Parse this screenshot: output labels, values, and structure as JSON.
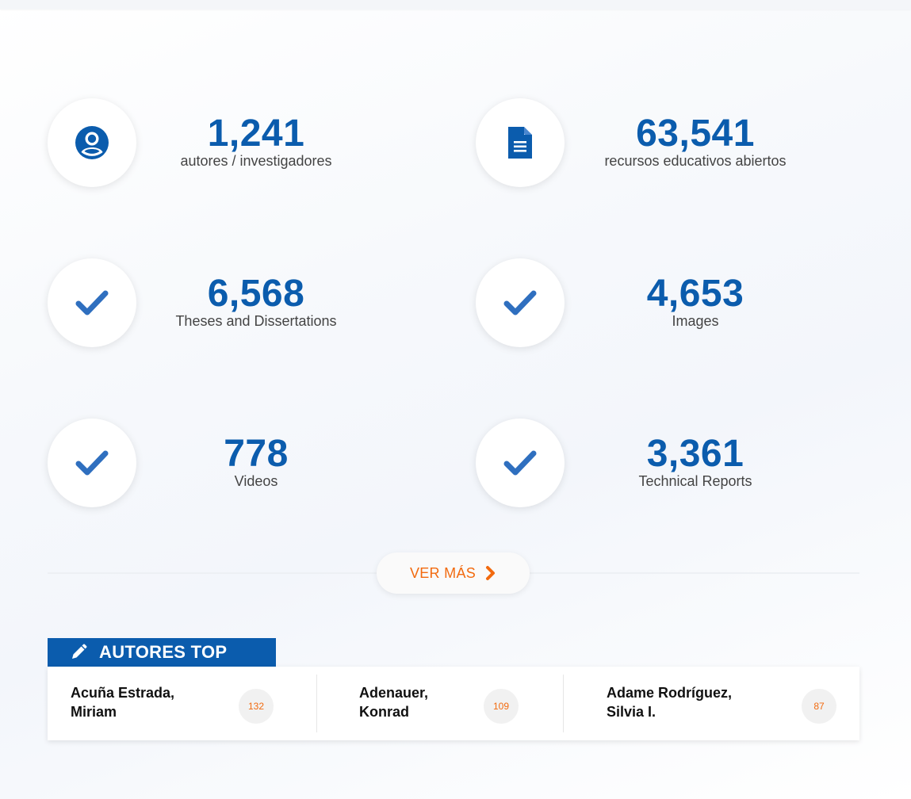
{
  "stats": [
    {
      "number": "1,241",
      "label": "autores / investigadores",
      "icon": "user-circle-icon"
    },
    {
      "number": "63,541",
      "label": "recursos educativos abiertos",
      "icon": "document-icon"
    },
    {
      "number": "6,568",
      "label": "Theses and Dissertations",
      "icon": "checkmark-icon"
    },
    {
      "number": "4,653",
      "label": "Images",
      "icon": "checkmark-icon"
    },
    {
      "number": "778",
      "label": "Videos",
      "icon": "checkmark-icon"
    },
    {
      "number": "3,361",
      "label": "Technical Reports",
      "icon": "checkmark-icon"
    }
  ],
  "ver_mas": {
    "label": "VER MÁS",
    "icon": "chevron-right-icon"
  },
  "autores_top": {
    "title": "AUTORES TOP",
    "icon": "pencil-icon",
    "authors": [
      {
        "name": "Acuña Estrada, Miriam",
        "count": "132"
      },
      {
        "name": "Adenauer, Konrad",
        "count": "109"
      },
      {
        "name": "Adame Rodríguez, Silvia I.",
        "count": "87"
      }
    ]
  },
  "colors": {
    "primary_blue": "#0b5cad",
    "icon_blue": "#2f6fbf",
    "accent_orange": "#f26a0f"
  }
}
